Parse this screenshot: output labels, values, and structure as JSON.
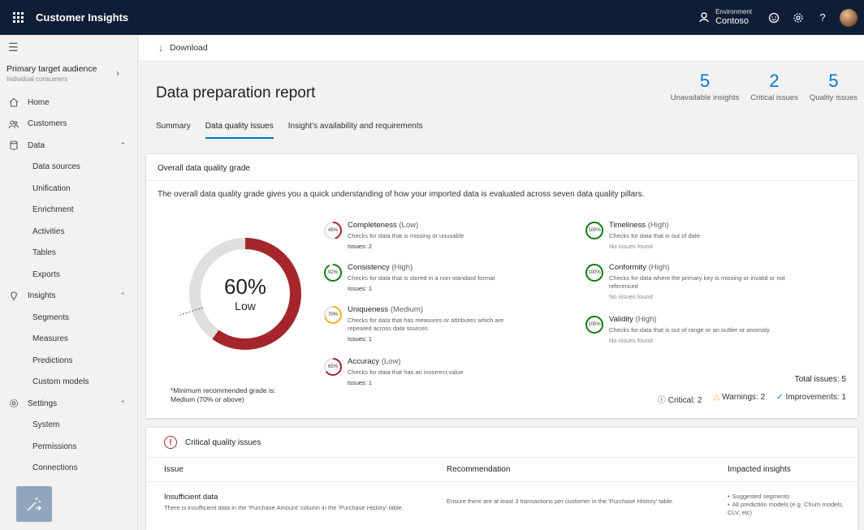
{
  "app": {
    "title": "Customer Insights",
    "environment_label": "Environment",
    "environment_value": "Contoso",
    "icons": [
      "waffle-icon",
      "environment-icon",
      "smiley-icon",
      "settings-icon",
      "help-icon",
      "avatar"
    ]
  },
  "sidebar": {
    "audience_title": "Primary target audience",
    "audience_sub": "Individual consumers",
    "items": [
      {
        "label": "Home",
        "icon": "home-icon"
      },
      {
        "label": "Customers",
        "icon": "customers-icon"
      },
      {
        "label": "Data",
        "icon": "data-icon",
        "expanded": true
      },
      {
        "label": "Data sources"
      },
      {
        "label": "Unification"
      },
      {
        "label": "Enrichment"
      },
      {
        "label": "Activities"
      },
      {
        "label": "Tables"
      },
      {
        "label": "Exports"
      },
      {
        "label": "Insights",
        "icon": "insights-icon",
        "expanded": true
      },
      {
        "label": "Segments"
      },
      {
        "label": "Measures"
      },
      {
        "label": "Predictions"
      },
      {
        "label": "Custom models"
      },
      {
        "label": "Settings",
        "icon": "settings-icon",
        "expanded": true
      },
      {
        "label": "System"
      },
      {
        "label": "Permissions"
      },
      {
        "label": "Connections"
      }
    ]
  },
  "toolbar": {
    "download_label": "Download"
  },
  "header": {
    "title": "Data preparation report",
    "stats": [
      {
        "value": "5",
        "label": "Unavailable insights"
      },
      {
        "value": "2",
        "label": "Critical issues"
      },
      {
        "value": "5",
        "label": "Quality issues"
      }
    ]
  },
  "tabs": [
    {
      "label": "Summary",
      "active": false
    },
    {
      "label": "Data quality issues",
      "active": true
    },
    {
      "label": "Insight's availability and requirements",
      "active": false
    }
  ],
  "grade_card": {
    "title": "Overall data quality grade",
    "description": "The overall data quality grade gives you a quick understanding of how your imported data is evaluated across seven data quality pillars.",
    "overall_percent": 60,
    "overall_label": "60%",
    "overall_grade": "Low",
    "min_note_line1": "*Minimum recommended grade is:",
    "min_note_line2": "Medium (70% or above)",
    "colors": {
      "low": "#a4262c",
      "medium": "#f2b21a",
      "high": "#107c10",
      "track": "#e1dfdd"
    },
    "pillars": [
      {
        "name": "Completeness",
        "level": "(Low)",
        "percent": 45,
        "pct_label": "45%",
        "desc": "Checks for data that is missing or unusable",
        "issues": "Issues: 2",
        "status": "low"
      },
      {
        "name": "Consistency",
        "level": "(High)",
        "percent": 92,
        "pct_label": "92%",
        "desc": "Checks for data that is stored in a non-standard format",
        "issues": "Issues: 1",
        "status": "high"
      },
      {
        "name": "Uniqueness",
        "level": "(Medium)",
        "percent": 70,
        "pct_label": "70%",
        "desc": "Checks for data that has measures or attributes which are repeated across data sources",
        "issues": "Issues: 1",
        "status": "medium"
      },
      {
        "name": "Accuracy",
        "level": "(Low)",
        "percent": 65,
        "pct_label": "65%",
        "desc": "Checks for data that has an incorrect value",
        "issues": "Issues: 1",
        "status": "low"
      },
      {
        "name": "Timeliness",
        "level": "(High)",
        "percent": 100,
        "pct_label": "100%",
        "desc": "Checks for data that is out of date",
        "issues": "No issues found",
        "status": "high"
      },
      {
        "name": "Conformity",
        "level": "(High)",
        "percent": 100,
        "pct_label": "100%",
        "desc": "Checks for data where the primary key is missing or invalid or not referenced",
        "issues": "No issues found",
        "status": "high"
      },
      {
        "name": "Validity",
        "level": "(High)",
        "percent": 100,
        "pct_label": "100%",
        "desc": "Checks for data that is out of range or an outlier or anomaly",
        "issues": "No issues found",
        "status": "high"
      }
    ],
    "total_issues": "Total issues: 5",
    "legend": [
      {
        "label": "Critical: 2",
        "icon": "critical-icon"
      },
      {
        "label": "Warnings: 2",
        "icon": "warning-icon"
      },
      {
        "label": "Improvements: 1",
        "icon": "improvement-icon"
      }
    ]
  },
  "critical_card": {
    "title": "Critical quality issues",
    "columns": [
      "Issue",
      "Recommendation",
      "Impacted insights"
    ],
    "rows": [
      {
        "issue_title": "Insufficient data",
        "issue_desc": "There is insufficient data in the 'Purchase Amount' column in the 'Purchase History' table.",
        "recommendation": "Ensure there are at least 3 transactions per customer in the 'Purchase History' table.",
        "impacted": [
          "Suggested segments",
          "All prediction models (e.g. Churn models, CLV, etc)"
        ]
      }
    ]
  }
}
